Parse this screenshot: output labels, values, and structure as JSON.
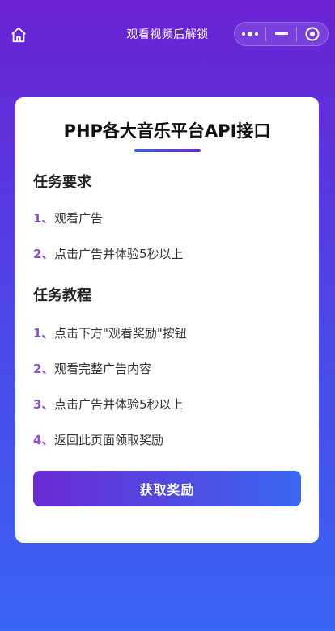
{
  "nav": {
    "title": "观看视频后解锁",
    "icons": [
      "home-icon",
      "more-dots-icon",
      "minimize-icon",
      "close-circle-icon"
    ]
  },
  "card": {
    "title": "PHP各大音乐平台API接口",
    "requirements": {
      "title": "任务要求",
      "steps": [
        {
          "num": "1、",
          "text": "观看广告"
        },
        {
          "num": "2、",
          "text": "点击广告并体验5秒以上"
        }
      ]
    },
    "tutorial": {
      "title": "任务教程",
      "steps": [
        {
          "num": "1、",
          "text": "点击下方\"观看奖励\"按钮"
        },
        {
          "num": "2、",
          "text": "观看完整广告内容"
        },
        {
          "num": "3、",
          "text": "点击广告并体验5秒以上"
        },
        {
          "num": "4、",
          "text": "返回此页面领取奖励"
        }
      ]
    },
    "button_label": "获取奖励"
  },
  "colors": {
    "accent_purple": "#6a2bd1",
    "accent_blue": "#3a66f0",
    "step_number": "#8a52c8"
  }
}
